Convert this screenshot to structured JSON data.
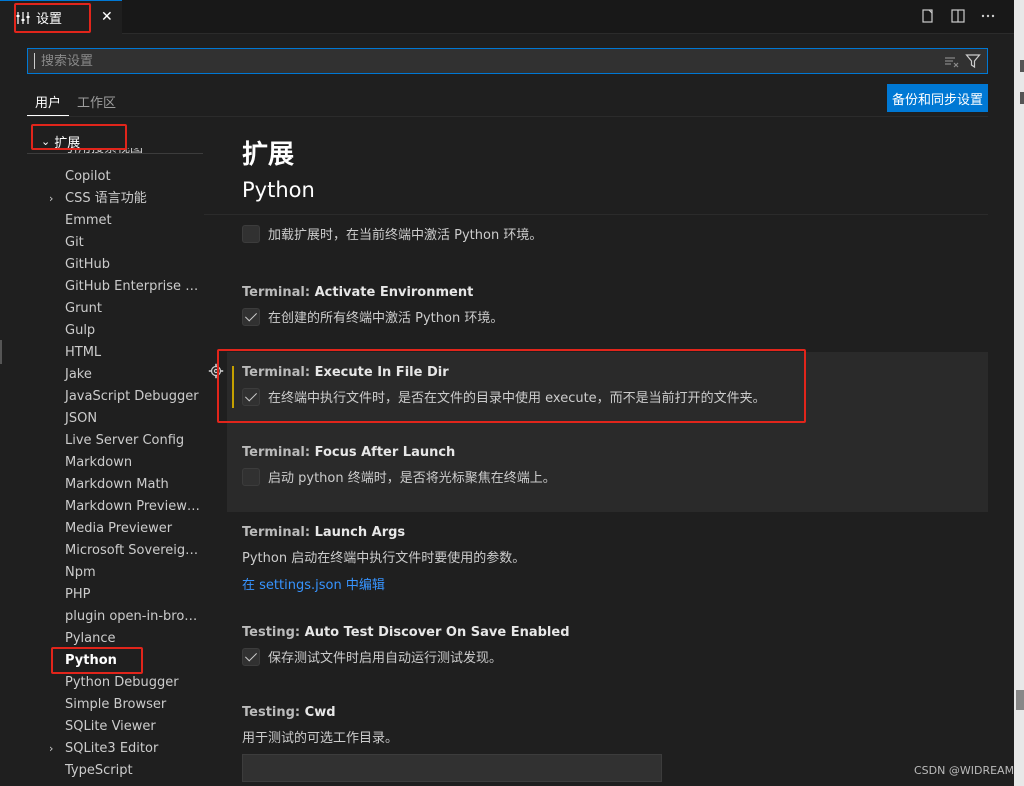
{
  "tab": {
    "label": "设置",
    "close": "✕"
  },
  "search": {
    "placeholder": "搜索设置"
  },
  "scope_tabs": [
    "用户",
    "工作区"
  ],
  "sync_button": "备份和同步设置",
  "tree": {
    "section": "扩展",
    "partial_item": "引用搜索视图",
    "items": [
      {
        "label": "Copilot",
        "chevron": false
      },
      {
        "label": "CSS 语言功能",
        "chevron": true
      },
      {
        "label": "Emmet",
        "chevron": false
      },
      {
        "label": "Git",
        "chevron": false
      },
      {
        "label": "GitHub",
        "chevron": false
      },
      {
        "label": "GitHub Enterprise Ser...",
        "chevron": false
      },
      {
        "label": "Grunt",
        "chevron": false
      },
      {
        "label": "Gulp",
        "chevron": false
      },
      {
        "label": "HTML",
        "chevron": false
      },
      {
        "label": "Jake",
        "chevron": false
      },
      {
        "label": "JavaScript Debugger",
        "chevron": false
      },
      {
        "label": "JSON",
        "chevron": false
      },
      {
        "label": "Live Server Config",
        "chevron": false
      },
      {
        "label": "Markdown",
        "chevron": false
      },
      {
        "label": "Markdown Math",
        "chevron": false
      },
      {
        "label": "Markdown Preview En...",
        "chevron": false
      },
      {
        "label": "Media Previewer",
        "chevron": false
      },
      {
        "label": "Microsoft Sovereign C...",
        "chevron": false
      },
      {
        "label": "Npm",
        "chevron": false
      },
      {
        "label": "PHP",
        "chevron": false
      },
      {
        "label": "plugin open-in-browser",
        "chevron": false
      },
      {
        "label": "Pylance",
        "chevron": false
      },
      {
        "label": "Python",
        "chevron": false,
        "active": true
      },
      {
        "label": "Python Debugger",
        "chevron": false
      },
      {
        "label": "Simple Browser",
        "chevron": false
      },
      {
        "label": "SQLite Viewer",
        "chevron": false
      },
      {
        "label": "SQLite3 Editor",
        "chevron": true
      },
      {
        "label": "TypeScript",
        "chevron": false
      }
    ]
  },
  "main": {
    "heading": "扩展",
    "subheading": "Python",
    "settings": [
      {
        "id": "activate-env-current",
        "category": "",
        "name": "",
        "desc": "加载扩展时，在当前终端中激活 Python 环境。",
        "type": "checkbox",
        "checked": false
      },
      {
        "id": "activate-environment",
        "category": "Terminal: ",
        "name": "Activate Environment",
        "desc": "在创建的所有终端中激活 Python 环境。",
        "type": "checkbox",
        "checked": true
      },
      {
        "id": "execute-in-file-dir",
        "category": "Terminal: ",
        "name": "Execute In File Dir",
        "desc": "在终端中执行文件时，是否在文件的目录中使用 execute，而不是当前打开的文件夹。",
        "type": "checkbox",
        "checked": true
      },
      {
        "id": "focus-after-launch",
        "category": "Terminal: ",
        "name": "Focus After Launch",
        "desc": "启动 python 终端时，是否将光标聚焦在终端上。",
        "type": "checkbox",
        "checked": false
      },
      {
        "id": "launch-args",
        "category": "Terminal: ",
        "name": "Launch Args",
        "desc": "Python 启动在终端中执行文件时要使用的参数。",
        "type": "link",
        "link": "在 settings.json 中编辑"
      },
      {
        "id": "auto-test-discover",
        "category": "Testing: ",
        "name": "Auto Test Discover On Save Enabled",
        "desc": "保存测试文件时启用自动运行测试发现。",
        "type": "checkbox",
        "checked": true
      },
      {
        "id": "testing-cwd",
        "category": "Testing: ",
        "name": "Cwd",
        "desc": "用于测试的可选工作目录。",
        "type": "text",
        "value": ""
      }
    ]
  },
  "watermark": "CSDN @WIDREAM"
}
